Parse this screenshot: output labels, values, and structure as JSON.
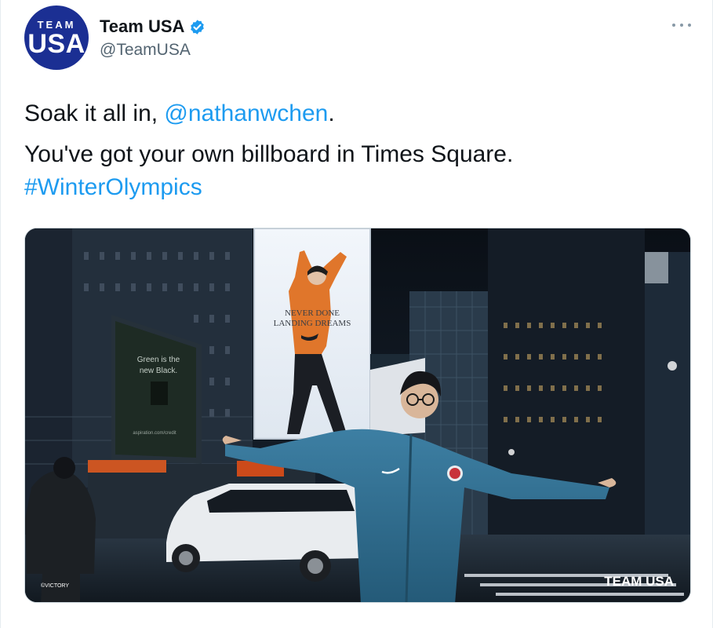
{
  "account": {
    "avatar_top": "TEAM",
    "avatar_bottom": "USA",
    "display_name": "Team USA",
    "handle": "@TeamUSA"
  },
  "tweet": {
    "prefix": "Soak it all in, ",
    "mention": "@nathanwchen",
    "suffix": ".",
    "line2": "You've got your own billboard in Times Square.",
    "hashtag": "#WinterOlympics"
  },
  "media": {
    "billboard_line1": "NEVER DONE",
    "billboard_line2": "LANDING DREAMS",
    "side_billboard_line1": "Green is the",
    "side_billboard_line2": "new Black.",
    "side_billboard_url": "aspiration.com/credit",
    "photo_credit": "©VICTORY",
    "watermark": "TEAM USA"
  },
  "colors": {
    "link": "#1d9bf0",
    "verified": "#1d9bf0",
    "avatar_bg": "#1b2f93"
  },
  "icons": [
    "verified-badge-icon",
    "more-options-icon"
  ]
}
